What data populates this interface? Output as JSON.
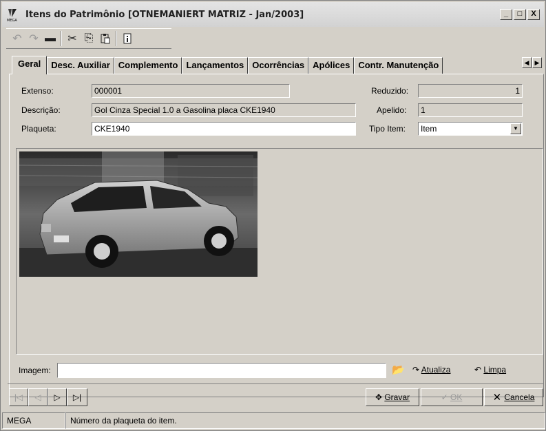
{
  "window": {
    "title": "Itens do Patrimônio [OTNEMANIERT MATRIZ - Jan/2003]",
    "logo_text": "MEGA",
    "controls": [
      "_",
      "□",
      "X"
    ]
  },
  "toolbar": {
    "buttons": [
      {
        "icon": "undo-icon",
        "glyph": "↶"
      },
      {
        "icon": "redo-icon",
        "glyph": "↷"
      },
      {
        "icon": "minus-icon",
        "glyph": "▬"
      },
      {
        "icon": "cut-icon",
        "glyph": "✂"
      },
      {
        "icon": "copy-icon",
        "glyph": "⎘"
      },
      {
        "icon": "paste-icon",
        "glyph": "📋"
      },
      {
        "icon": "info-icon",
        "glyph": "ⓘ"
      }
    ]
  },
  "tabs": [
    "Geral",
    "Desc. Auxiliar",
    "Complemento",
    "Lançamentos",
    "Ocorrências",
    "Apólices",
    "Contr. Manutenção"
  ],
  "form": {
    "extenso_label": "Extenso:",
    "extenso_value": "000001",
    "descricao_label": "Descrição:",
    "descricao_value": "Gol Cinza Special 1.0 a Gasolina placa CKE1940",
    "plaqueta_label": "Plaqueta:",
    "plaqueta_value": "CKE1940",
    "reduzido_label": "Reduzido:",
    "reduzido_value": "1",
    "apelido_label": "Apelido:",
    "apelido_value": "1",
    "tipo_item_label": "Tipo Item:",
    "tipo_item_value": "Item"
  },
  "image": {
    "label": "Imagem:",
    "value": "",
    "atualiza_label": "Atualiza",
    "limpa_label": "Limpa"
  },
  "nav": {
    "gravar_label": "Gravar",
    "ok_label": "OK",
    "cancela_label": "Cancela"
  },
  "status": {
    "app": "MEGA",
    "message": "Número da plaqueta do item."
  },
  "colors": {
    "window_bg": "#d4d0c8",
    "field_readonly": "#d4d0c8",
    "field_editable": "#ffffff"
  }
}
